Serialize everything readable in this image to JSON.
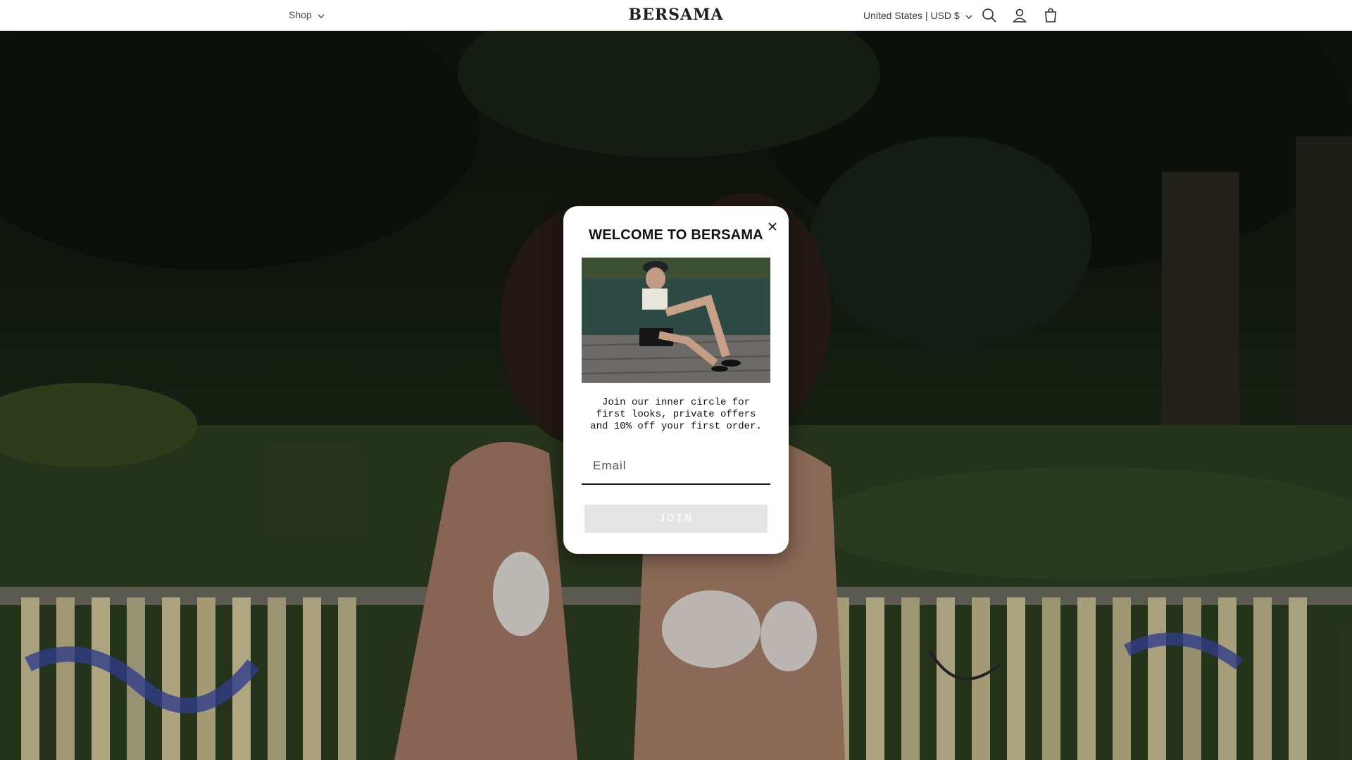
{
  "header": {
    "shop_label": "Shop",
    "logo_text": "BERSAMA",
    "currency_label": "United States | USD $",
    "icons": [
      "search-icon",
      "account-icon",
      "cart-icon"
    ]
  },
  "modal": {
    "title": "WELCOME TO BERSAMA",
    "body_text": "Join our inner circle for first looks, private offers and 10% off your first order.",
    "email_placeholder": "Email",
    "join_label": "JOIN",
    "close_icon": "close-icon"
  },
  "colors": {
    "modal_bg": "#ffffff",
    "join_button_bg": "#e6e6e6",
    "overlay": "rgba(0,0,0,0.18)"
  }
}
